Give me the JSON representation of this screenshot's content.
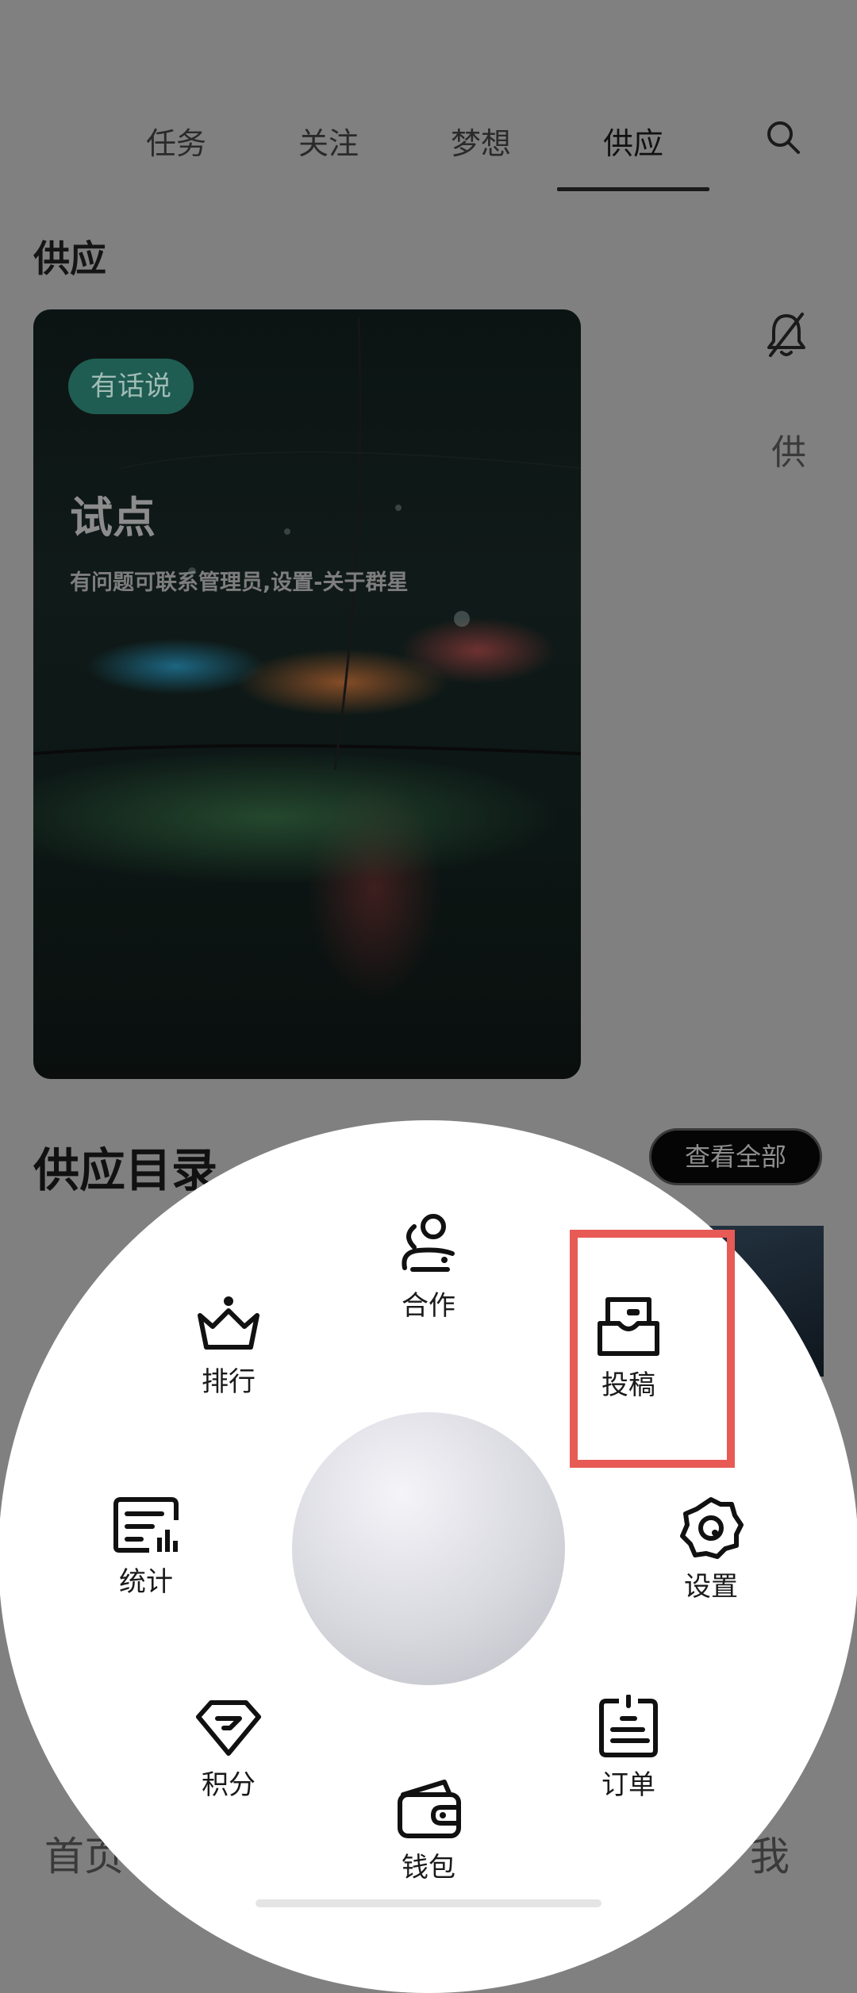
{
  "tabs": [
    {
      "label": "任务"
    },
    {
      "label": "关注"
    },
    {
      "label": "梦想"
    },
    {
      "label": "供应"
    }
  ],
  "section_title": "供应",
  "hero": {
    "badge": "有话说",
    "title": "试点",
    "subtitle": "有问题可联系管理员,设置-关于群星"
  },
  "side_char": "供",
  "catalog": {
    "title": "供应目录",
    "view_all": "查看全部"
  },
  "bottom_nav": {
    "home": "首页",
    "me": "我"
  },
  "radial_menu": {
    "cooperate": "合作",
    "ranking": "排行",
    "submit": "投稿",
    "stats": "统计",
    "settings": "设置",
    "points": "积分",
    "orders": "订单",
    "wallet": "钱包"
  },
  "colors": {
    "overlay": "#808080",
    "highlight": "#e85a55",
    "badge_bg": "#1f5c52"
  }
}
